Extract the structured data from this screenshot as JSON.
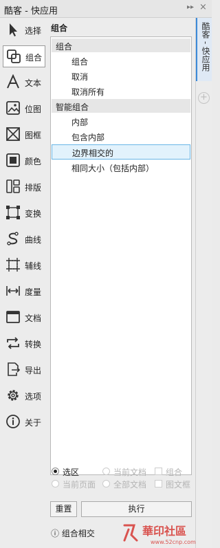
{
  "window": {
    "title": "酷客 - 快应用",
    "ctl_expand": "▸▸",
    "ctl_close": "×"
  },
  "sidebar": {
    "items": [
      {
        "label": "选择",
        "icon": "cursor-icon"
      },
      {
        "label": "组合",
        "icon": "group-icon"
      },
      {
        "label": "文本",
        "icon": "text-icon"
      },
      {
        "label": "位图",
        "icon": "image-icon"
      },
      {
        "label": "图框",
        "icon": "frame-icon"
      },
      {
        "label": "颜色",
        "icon": "color-icon"
      },
      {
        "label": "排版",
        "icon": "layout-icon"
      },
      {
        "label": "变换",
        "icon": "transform-icon"
      },
      {
        "label": "曲线",
        "icon": "curve-icon"
      },
      {
        "label": "辅线",
        "icon": "guide-icon"
      },
      {
        "label": "度量",
        "icon": "measure-icon"
      },
      {
        "label": "文档",
        "icon": "document-icon"
      },
      {
        "label": "转换",
        "icon": "convert-icon"
      },
      {
        "label": "导出",
        "icon": "export-icon"
      },
      {
        "label": "选项",
        "icon": "gear-icon"
      },
      {
        "label": "关于",
        "icon": "info-icon"
      }
    ],
    "active_index": 1
  },
  "main": {
    "title": "组合",
    "groups": [
      {
        "header": "组合",
        "items": [
          "组合",
          "取消",
          "取消所有"
        ]
      },
      {
        "header": "智能组合",
        "items": [
          "内部",
          "包含内部",
          "边界相交的",
          "相同大小（包括内部）"
        ]
      }
    ],
    "selected_item": "边界相交的",
    "options": {
      "selection": "选区",
      "current_doc": "当前文档",
      "group": "组合",
      "current_page": "当前页面",
      "all_docs": "全部文档",
      "graphic_frame": "图文框"
    },
    "buttons": {
      "reset": "重置",
      "execute": "执行"
    },
    "status_icon": "ⓘ",
    "status": "组合相交"
  },
  "right_panel": {
    "tab": "酷客 - 快应用",
    "add": "+"
  },
  "watermark": {
    "text": "華印社區",
    "url": "www.52cnp.com"
  },
  "colors": {
    "selection_border": "#68b5e6",
    "selection_fill": "#e2f2fc",
    "tab_accent": "#3c8ad8",
    "watermark": "#d9534f"
  }
}
